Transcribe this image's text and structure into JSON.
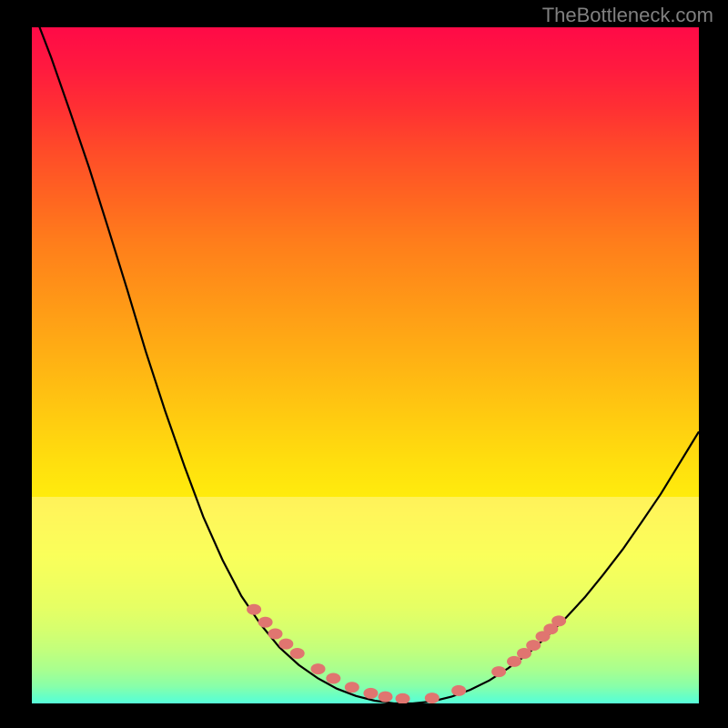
{
  "watermark": "TheBottleneck.com",
  "chart_data": {
    "type": "line",
    "title": "",
    "xlabel": "",
    "ylabel": "",
    "xlim": [
      0,
      1
    ],
    "ylim": [
      0,
      1
    ],
    "series": [
      {
        "name": "curve",
        "x": [
          0.0,
          0.029,
          0.057,
          0.086,
          0.114,
          0.143,
          0.171,
          0.2,
          0.229,
          0.257,
          0.286,
          0.314,
          0.343,
          0.371,
          0.4,
          0.429,
          0.457,
          0.486,
          0.514,
          0.543,
          0.571,
          0.6,
          0.629,
          0.657,
          0.686,
          0.714,
          0.743,
          0.771,
          0.8,
          0.829,
          0.857,
          0.886,
          0.914,
          0.943,
          0.971,
          1.0
        ],
        "y": [
          1.03,
          0.955,
          0.876,
          0.792,
          0.704,
          0.612,
          0.52,
          0.432,
          0.35,
          0.276,
          0.212,
          0.159,
          0.117,
          0.083,
          0.057,
          0.037,
          0.022,
          0.011,
          0.004,
          0.0,
          0.0,
          0.003,
          0.01,
          0.02,
          0.034,
          0.052,
          0.073,
          0.098,
          0.126,
          0.157,
          0.191,
          0.228,
          0.268,
          0.31,
          0.355,
          0.402
        ]
      }
    ],
    "highlight_points": {
      "x": [
        0.333,
        0.35,
        0.365,
        0.381,
        0.398,
        0.429,
        0.452,
        0.48,
        0.508,
        0.53,
        0.556,
        0.6,
        0.64,
        0.7,
        0.723,
        0.738,
        0.752,
        0.766,
        0.778,
        0.79
      ],
      "y": [
        0.139,
        0.12,
        0.103,
        0.088,
        0.074,
        0.051,
        0.037,
        0.024,
        0.015,
        0.01,
        0.007,
        0.008,
        0.019,
        0.047,
        0.062,
        0.074,
        0.086,
        0.099,
        0.11,
        0.122
      ]
    },
    "band": {
      "y_top": 0.306,
      "y_bottom": 0.0
    }
  }
}
